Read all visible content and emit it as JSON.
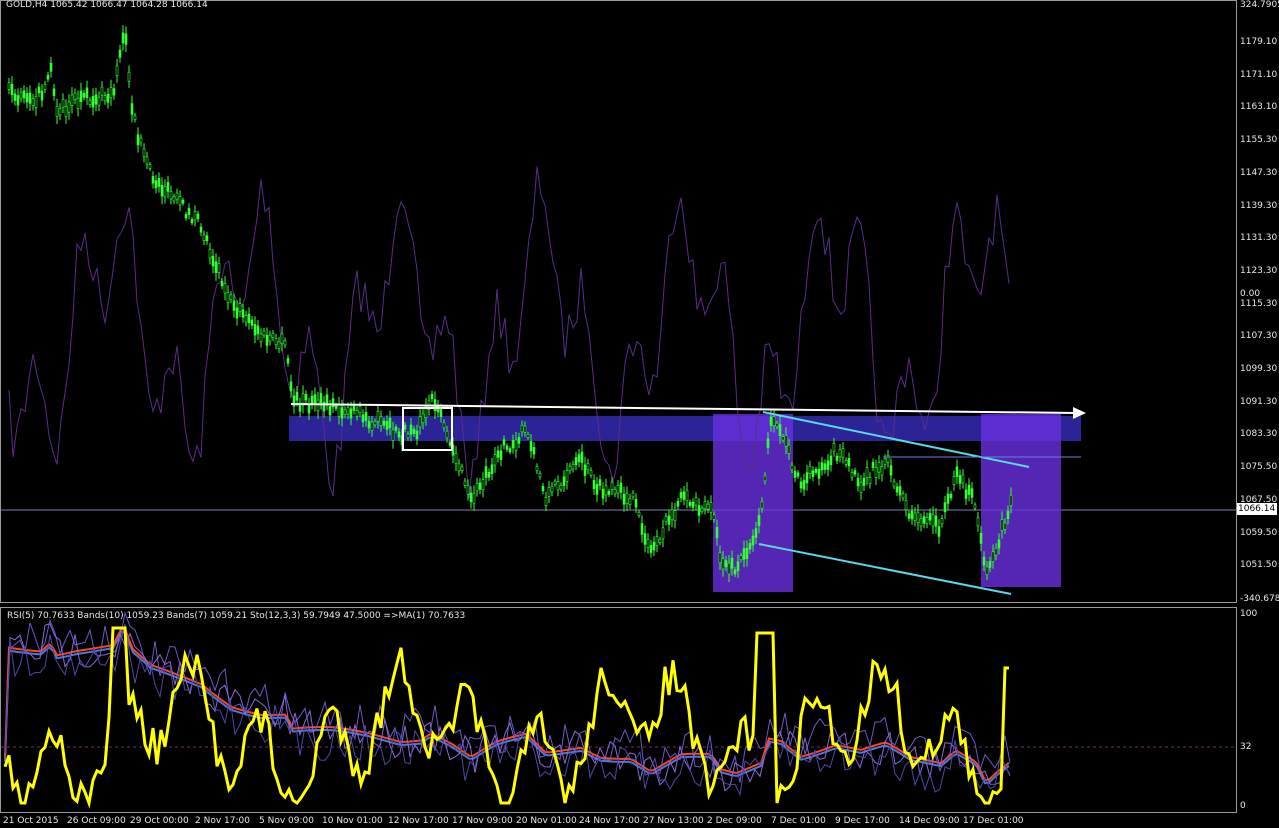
{
  "chart_header": {
    "symbol_timeframe": "GOLD,H4",
    "ohlc": "1065.42 1066.47 1064.28 1066.14"
  },
  "price_axis": {
    "labels": [
      "1179.10",
      "1171.10",
      "1163.10",
      "1155.30",
      "1147.30",
      "1139.30",
      "1131.30",
      "1123.30",
      "1115.30",
      "1107.30",
      "1099.30",
      "1091.30",
      "1083.30",
      "1075.50",
      "1067.50",
      "1059.50",
      "1051.50"
    ],
    "overlay_top": "324.7905",
    "overlay_mid": "0.00",
    "overlay_bottom": "-340.6785",
    "current_price": "1066.14"
  },
  "indicator": {
    "legend": "RSI(5) 70.7633  Bands(10) 1059.23  Bands(7) 1059.21  Sto(12,3,3) 59.7949 47.5000  =>MA(1) 70.7633",
    "axis_top": "100",
    "axis_mid": "32",
    "axis_bottom": "0"
  },
  "time_axis": {
    "labels": [
      "21 Oct 2015",
      "26 Oct 09:00",
      "29 Oct 00:00",
      "2 Nov 17:00",
      "5 Nov 09:00",
      "10 Nov 01:00",
      "12 Nov 17:00",
      "17 Nov 09:00",
      "20 Nov 01:00",
      "24 Nov 17:00",
      "27 Nov 13:00",
      "2 Dec 09:00",
      "7 Dec 01:00",
      "9 Dec 17:00",
      "14 Dec 09:00",
      "17 Dec 01:00"
    ]
  },
  "colors": {
    "candles": "#33ff33",
    "cci": "#5a2d8a",
    "zone": "#3a2fc8",
    "channel": "#5ad7e8",
    "rsi": "#ffff00",
    "ma_red": "#ff4422",
    "ma_blue": "#4a7ad8"
  }
}
